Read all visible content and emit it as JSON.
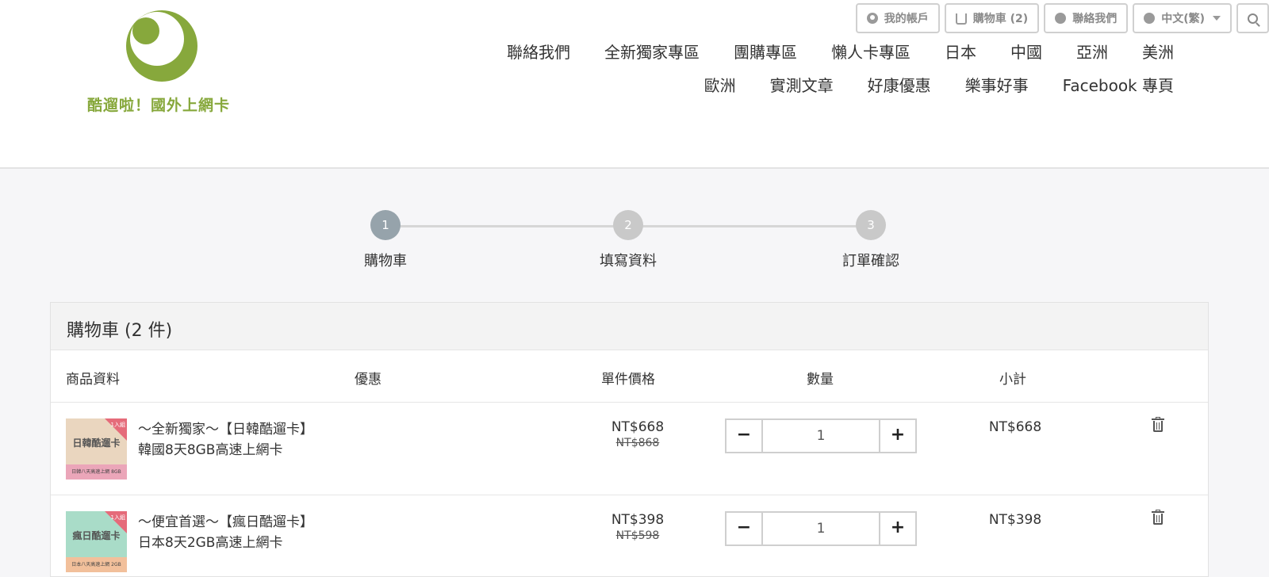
{
  "header": {
    "logo_text": "酷遛啦！國外上網卡",
    "topbar": {
      "account": "我的帳戶",
      "cart": "購物車 (2)",
      "contact": "聯絡我們",
      "language": "中文(繁)"
    },
    "nav_row1": [
      "聯絡我們",
      "全新獨家專區",
      "團購專區",
      "懶人卡專區",
      "日本",
      "中國",
      "亞洲",
      "美洲"
    ],
    "nav_row2": [
      "歐洲",
      "實測文章",
      "好康優惠",
      "樂事好事",
      "Facebook 專頁"
    ]
  },
  "steps": [
    {
      "number": "1",
      "label": "購物車"
    },
    {
      "number": "2",
      "label": "填寫資料"
    },
    {
      "number": "3",
      "label": "訂單確認"
    }
  ],
  "cart": {
    "title": "購物車 (2 件)",
    "columns": {
      "product": "商品資料",
      "discount": "優惠",
      "unit_price": "單件價格",
      "quantity": "數量",
      "subtotal": "小計"
    },
    "items": [
      {
        "name_line1": "～全新獨家～【日韓酷遛卡】",
        "name_line2": "韓國8天8GB高速上網卡",
        "thumb_title": "日韓酷遛卡",
        "thumb_badge": "1入組",
        "thumb_caption": "日韓八天高速上網 8GB",
        "price": "NT$668",
        "original_price": "NT$868",
        "quantity": "1",
        "subtotal": "NT$668",
        "minus": "−",
        "plus": "+"
      },
      {
        "name_line1": "～便宜首選～【瘋日酷遛卡】",
        "name_line2": "日本8天2GB高速上網卡",
        "thumb_title": "瘋日酷遛卡",
        "thumb_badge": "1入組",
        "thumb_caption": "日本八天高速上網 2GB",
        "price": "NT$398",
        "original_price": "NT$598",
        "quantity": "1",
        "subtotal": "NT$398",
        "minus": "−",
        "plus": "+"
      }
    ]
  },
  "icons": [
    "user-icon",
    "cart-icon",
    "chat-icon",
    "globe-icon",
    "caret-down-icon",
    "search-icon",
    "trash-icon"
  ],
  "colors": {
    "brand_green": "#87a83c",
    "step_active": "#96a3ab",
    "step_inactive": "#c9c9c9",
    "thumb1_top": "#ead6bf",
    "thumb1_bottom": "#eba6b9",
    "thumb2_top": "#a9dcc8",
    "thumb2_bottom": "#f2c09b"
  }
}
